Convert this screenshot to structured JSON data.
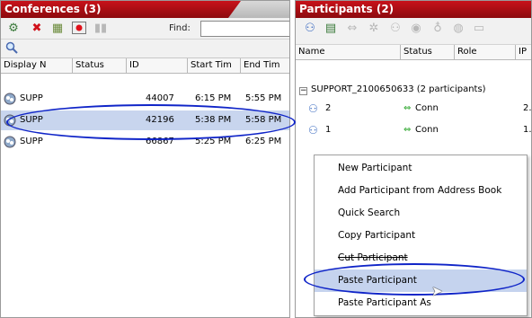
{
  "conferences": {
    "title": "Conferences (3)",
    "find_label": "Find:",
    "find_value": "",
    "columns": [
      "Display N",
      "Status",
      "ID",
      "Start Tim",
      "End Tim"
    ],
    "rows": [
      {
        "name": "SUPP",
        "status": "",
        "id": "44007",
        "start": "6:15 PM",
        "end": "5:55 PM"
      },
      {
        "name": "SUPP",
        "status": "",
        "id": "42196",
        "start": "5:38 PM",
        "end": "5:58 PM"
      },
      {
        "name": "SUPP",
        "status": "",
        "id": "66867",
        "start": "5:25 PM",
        "end": "6:25 PM"
      }
    ],
    "selected_row": 1
  },
  "participants": {
    "title": "Participants (2)",
    "columns": [
      "Name",
      "Status",
      "Role",
      "IP"
    ],
    "group_label": "SUPPORT_2100650633 (2  participants)",
    "rows": [
      {
        "name": "2",
        "status": "Conn",
        "ip": "2."
      },
      {
        "name": "1",
        "status": "Conn",
        "ip": "1."
      }
    ]
  },
  "context_menu": {
    "items": [
      {
        "label": "New Participant"
      },
      {
        "label": "Add Participant from Address Book"
      },
      {
        "label": "Quick Search"
      },
      {
        "label": "Copy Participant"
      },
      {
        "label": "Cut Participant"
      },
      {
        "label": "Paste Participant"
      },
      {
        "label": "Paste Participant As"
      }
    ],
    "highlighted_index": 5
  },
  "colors": {
    "title_bar": "#b0101a",
    "selection": "#c8d5ee",
    "annotation_ellipse": "#1025c8",
    "connected_icon": "#2aa52a"
  },
  "icons": {
    "conference_row": "conference-icon",
    "participant_row": "participant-icon",
    "connection_status": "connected-icon",
    "search": "search-icon"
  }
}
